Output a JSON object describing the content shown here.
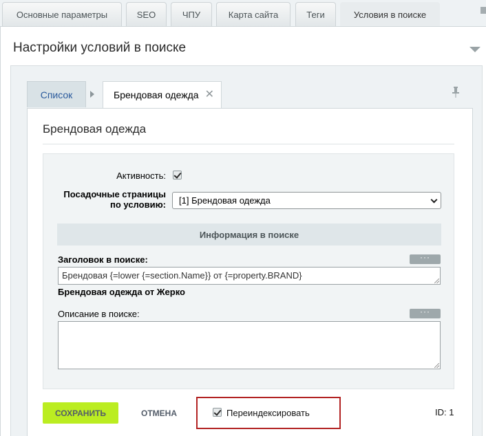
{
  "top_tabs": [
    {
      "label": "Основные параметры"
    },
    {
      "label": "SEO"
    },
    {
      "label": "ЧПУ"
    },
    {
      "label": "Карта сайта"
    },
    {
      "label": "Теги"
    },
    {
      "label": "Условия в поиске"
    }
  ],
  "active_top_tab": "Условия в поиске",
  "settings": {
    "title": "Настройки условий в поиске"
  },
  "subtabs": {
    "list_label": "Список",
    "edit_label": "Брендовая одежда"
  },
  "card": {
    "title": "Брендовая одежда"
  },
  "form": {
    "active_label": "Активность:",
    "active_checked": true,
    "landing_label_line1": "Посадочные страницы",
    "landing_label_line2": "по условию:",
    "landing_selected": "[1] Брендовая одежда",
    "section_title": "Информация в поиске",
    "search_title_label": "Заголовок в поиске:",
    "search_title_value": "Брендовая {=lower {=section.Name}} от {=property.BRAND}",
    "search_title_preview": "Брендовая одежда от Жерко",
    "description_label": "Описание в поиске:",
    "description_value": "",
    "more_button_label": "···"
  },
  "footer": {
    "save_label": "СОХРАНИТЬ",
    "cancel_label": "ОТМЕНА",
    "reindex_label": "Переиндексировать",
    "reindex_checked": true,
    "id_text": "ID: 1"
  },
  "colors": {
    "save_button": "#bbed21",
    "highlight_border": "#b22222",
    "link_blue": "#2a5a9c"
  }
}
